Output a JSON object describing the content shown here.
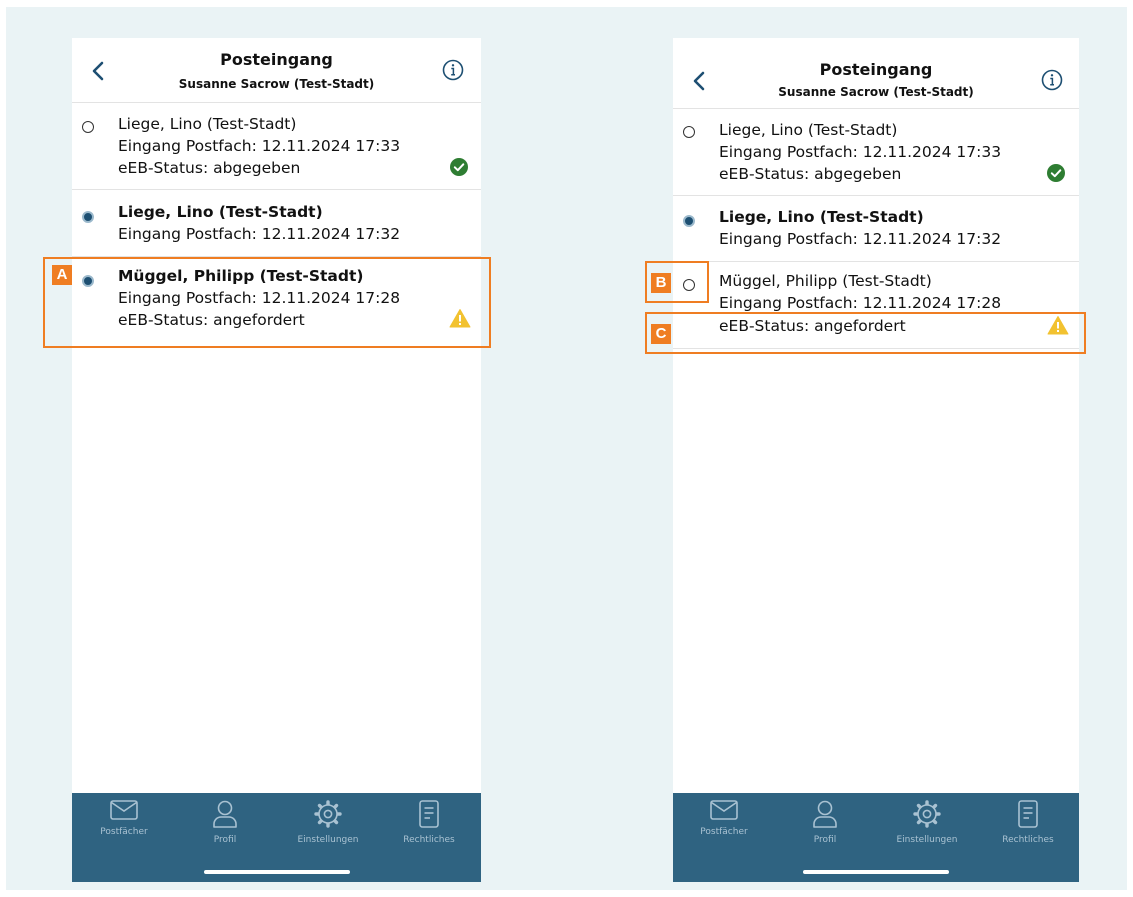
{
  "colors": {
    "accent": "#ef7d22",
    "tabbar": "#2f6381",
    "radio_selected": "#1d4f72",
    "status_ok": "#2e7d32",
    "status_warning": "#f2c230"
  },
  "screens": [
    {
      "header": {
        "title": "Posteingang",
        "subtitle": "Susanne Sacrow (Test-Stadt)",
        "back_icon": "chevron-left-icon",
        "info_icon": "info-circle-icon"
      },
      "messages": [
        {
          "unread": false,
          "selected": false,
          "sender": "Liege, Lino (Test-Stadt)",
          "received": "Eingang Postfach: 12.11.2024 17:33",
          "status": "eEB-Status: abgegeben",
          "status_icon": "check-circle-icon"
        },
        {
          "unread": true,
          "selected": true,
          "sender": "Liege, Lino (Test-Stadt)",
          "received": "Eingang Postfach: 12.11.2024 17:32",
          "status": null,
          "status_icon": null
        },
        {
          "unread": true,
          "selected": true,
          "sender": "Müggel, Philipp (Test-Stadt)",
          "received": "Eingang Postfach: 12.11.2024 17:28",
          "status": "eEB-Status: angefordert",
          "status_icon": "warning-triangle-icon"
        }
      ],
      "callouts": [
        "A"
      ],
      "tabs": [
        {
          "label": "Postfächer",
          "icon": "envelope-icon"
        },
        {
          "label": "Profil",
          "icon": "person-icon"
        },
        {
          "label": "Einstellungen",
          "icon": "gear-icon"
        },
        {
          "label": "Rechtliches",
          "icon": "document-icon"
        }
      ]
    },
    {
      "header": {
        "title": "Posteingang",
        "subtitle": "Susanne Sacrow (Test-Stadt)",
        "back_icon": "chevron-left-icon",
        "info_icon": "info-circle-icon"
      },
      "messages": [
        {
          "unread": false,
          "selected": false,
          "sender": "Liege, Lino (Test-Stadt)",
          "received": "Eingang Postfach: 12.11.2024 17:33",
          "status": "eEB-Status: abgegeben",
          "status_icon": "check-circle-icon"
        },
        {
          "unread": true,
          "selected": true,
          "sender": "Liege, Lino (Test-Stadt)",
          "received": "Eingang Postfach: 12.11.2024 17:32",
          "status": null,
          "status_icon": null
        },
        {
          "unread": false,
          "selected": false,
          "sender": "Müggel, Philipp (Test-Stadt)",
          "received": "Eingang Postfach: 12.11.2024 17:28",
          "status": "eEB-Status: angefordert",
          "status_icon": "warning-triangle-icon"
        }
      ],
      "callouts": [
        "B",
        "C"
      ],
      "tabs": [
        {
          "label": "Postfächer",
          "icon": "envelope-icon"
        },
        {
          "label": "Profil",
          "icon": "person-icon"
        },
        {
          "label": "Einstellungen",
          "icon": "gear-icon"
        },
        {
          "label": "Rechtliches",
          "icon": "document-icon"
        }
      ]
    }
  ]
}
